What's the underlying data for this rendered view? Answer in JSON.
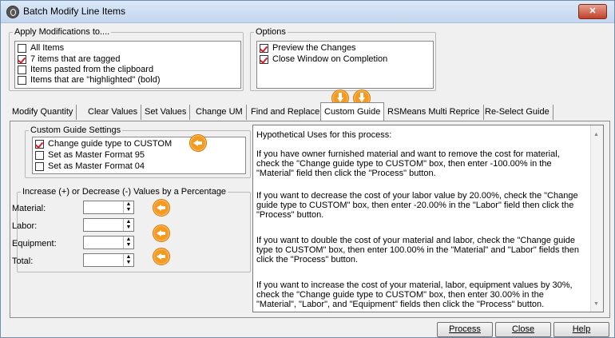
{
  "window": {
    "title": "Batch Modify Line Items",
    "close_glyph": "✕"
  },
  "apply": {
    "legend": "Apply Modifications to....",
    "items": [
      {
        "label": "All Items",
        "checked": false
      },
      {
        "label": "7 items that are tagged",
        "checked": true
      },
      {
        "label": "Items pasted from the clipboard",
        "checked": false
      },
      {
        "label": "Items that are \"highlighted\" (bold)",
        "checked": false
      }
    ]
  },
  "options": {
    "legend": "Options",
    "items": [
      {
        "label": "Preview the Changes",
        "checked": true
      },
      {
        "label": "Close Window on Completion",
        "checked": true
      }
    ]
  },
  "tabs": [
    {
      "label": "Modify Quantity"
    },
    {
      "label": "Clear Values"
    },
    {
      "label": "Set Values"
    },
    {
      "label": "Change UM"
    },
    {
      "label": "Find and Replace"
    },
    {
      "label": "Custom Guide",
      "active": true
    },
    {
      "label": "RSMeans Multi Reprice"
    },
    {
      "label": "Re-Select Guide"
    }
  ],
  "custom_guide": {
    "legend": "Custom Guide Settings",
    "items": [
      {
        "label": "Change guide type to CUSTOM",
        "checked": true
      },
      {
        "label": "Set as Master Format 95",
        "checked": false
      },
      {
        "label": "Set as Master Format 04",
        "checked": false
      }
    ]
  },
  "percentage": {
    "legend": "Increase (+) or Decrease (-) Values by a Percentage",
    "fields": [
      {
        "label": "Material:",
        "value": ""
      },
      {
        "label": "Labor:",
        "value": ""
      },
      {
        "label": "Equipment:",
        "value": ""
      },
      {
        "label": "Total:",
        "value": ""
      }
    ]
  },
  "info": {
    "paragraphs": [
      "Hypothetical Uses for this process:",
      "If you have owner furnished material and want to remove the cost for material, check the \"Change guide type to CUSTOM\" box, then enter -100.00% in the \"Material\" field then click the \"Process\" button.",
      "If you want to decrease the cost of your labor value by 20.00%, check the \"Change guide type to CUSTOM\" box, then enter -20.00% in the \"Labor\" field then click the \"Process\" button.",
      "If you want to double the cost of your material and labor, check the \"Change guide type to CUSTOM\" box, then enter 100.00% in the \"Material\" and \"Labor\" fields then click the \"Process\" button.",
      "If you want to increase the cost of your material, labor, equipment values by 30%, check the \"Change guide type to CUSTOM\" box, then enter 30.00% in the \"Material\", \"Labor\", and \"Equipment\" fields then click the \"Process\" button."
    ]
  },
  "buttons": {
    "process": "Process",
    "close": "Close",
    "help": "Help"
  },
  "icons": {
    "arrow": "orange-arrow-icon",
    "accent": "#f39a1f",
    "check_color": "#d0202a"
  }
}
